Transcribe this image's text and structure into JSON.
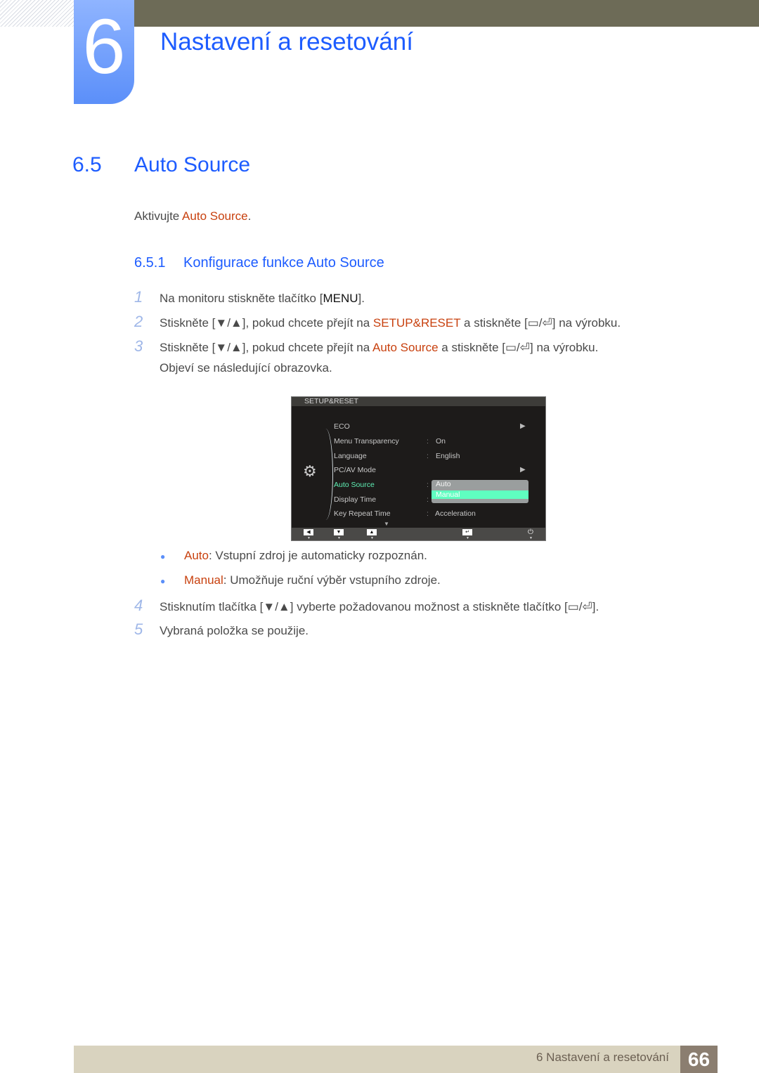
{
  "chapter": {
    "number": "6",
    "title": "Nastavení a resetování"
  },
  "section": {
    "number": "6.5",
    "title": "Auto Source"
  },
  "intro": {
    "prefix": "Aktivujte ",
    "highlight": "Auto Source",
    "suffix": "."
  },
  "subsection": {
    "number": "6.5.1",
    "title": "Konfigurace funkce Auto Source"
  },
  "steps": [
    {
      "n": "1",
      "a": "Na monitoru stiskněte tlačítko [",
      "key": "MENU",
      "b": "]."
    },
    {
      "n": "2",
      "a": "Stiskněte [▼/▲], pokud chcete přejít na ",
      "hl": "SETUP&RESET",
      "b": " a stiskněte [▭/⏎] na výrobku."
    },
    {
      "n": "3",
      "a": "Stiskněte [▼/▲], pokud chcete přejít na ",
      "hl": "Auto Source",
      "b": " a stiskněte [▭/⏎] na výrobku."
    },
    {
      "n": "",
      "a": "Objeví se následující obrazovka."
    },
    {
      "n": "4",
      "a": "Stisknutím tlačítka [▼/▲] vyberte požadovanou možnost a stiskněte tlačítko [▭/⏎]."
    },
    {
      "n": "5",
      "a": "Vybraná položka se použije."
    }
  ],
  "bullets": [
    {
      "hl": "Auto",
      "text": ": Vstupní zdroj je automaticky rozpoznán."
    },
    {
      "hl": "Manual",
      "text": ": Umožňuje ruční výběr vstupního zdroje."
    }
  ],
  "osd": {
    "header": "SETUP&RESET",
    "items": [
      {
        "label": "ECO",
        "value": "",
        "arrow": "▶"
      },
      {
        "label": "Menu Transparency",
        "value": "On"
      },
      {
        "label": "Language",
        "value": "English"
      },
      {
        "label": "PC/AV Mode",
        "value": "",
        "arrow": "▶"
      },
      {
        "label": "Auto Source",
        "value": ""
      },
      {
        "label": "Display Time",
        "value": ""
      },
      {
        "label": "Key Repeat Time",
        "value": "Acceleration"
      }
    ],
    "dropdown": {
      "options": [
        "Auto",
        "Manual"
      ],
      "selected": "Manual"
    },
    "footer_buttons": [
      "◀",
      "▼",
      "▲",
      "↵",
      "⏻"
    ]
  },
  "footer": {
    "chapter_label": "6 Nastavení a resetování",
    "page": "66"
  }
}
